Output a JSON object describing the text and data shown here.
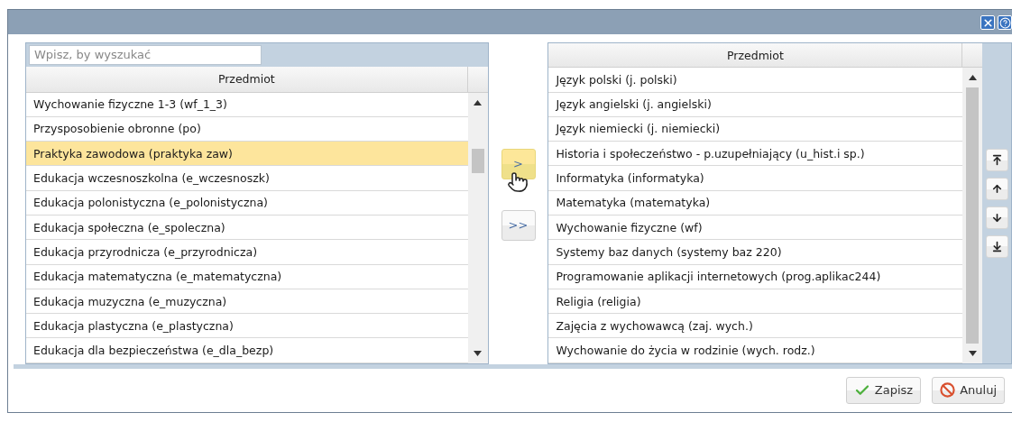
{
  "window": {
    "title_buttons": [
      {
        "kind": "close"
      },
      {
        "kind": "help"
      }
    ]
  },
  "available": {
    "search": {
      "placeholder": "Wpisz, by wyszukać"
    },
    "column": "Przedmiot",
    "rows": [
      {
        "label": "Wychowanie fizyczne 1-3 (wf_1_3)",
        "selected": false
      },
      {
        "label": "Przysposobienie obronne (po)",
        "selected": false
      },
      {
        "label": "Praktyka zawodowa (praktyka zaw)",
        "selected": true
      },
      {
        "label": "Edukacja wczesnoszkolna (e_wczesnoszk)",
        "selected": false
      },
      {
        "label": "Edukacja polonistyczna (e_polonistyczna)",
        "selected": false
      },
      {
        "label": "Edukacja społeczna (e_spoleczna)",
        "selected": false
      },
      {
        "label": "Edukacja przyrodnicza (e_przyrodnicza)",
        "selected": false
      },
      {
        "label": "Edukacja matematyczna (e_matematyczna)",
        "selected": false
      },
      {
        "label": "Edukacja muzyczna (e_muzyczna)",
        "selected": false
      },
      {
        "label": "Edukacja plastyczna (e_plastyczna)",
        "selected": false
      },
      {
        "label": "Edukacja dla bezpieczeństwa (e_dla_bezp)",
        "selected": false
      }
    ]
  },
  "transfer_buttons": [
    {
      "label": ">",
      "hovered": true
    },
    {
      "label": ">>",
      "hovered": false
    }
  ],
  "chosen": {
    "column": "Przedmiot",
    "rows": [
      {
        "label": "Język polski (j. polski)",
        "selected": false
      },
      {
        "label": "Język angielski (j. angielski)",
        "selected": false
      },
      {
        "label": "Język niemiecki (j. niemiecki)",
        "selected": false
      },
      {
        "label": "Historia i społeczeństwo - p.uzupełniający (u_hist.i sp.)",
        "selected": false
      },
      {
        "label": "Informatyka (informatyka)",
        "selected": false
      },
      {
        "label": "Matematyka (matematyka)",
        "selected": false
      },
      {
        "label": "Wychowanie fizyczne (wf)",
        "selected": false
      },
      {
        "label": "Systemy baz danych (systemy baz 220)",
        "selected": false
      },
      {
        "label": "Programowanie aplikacji internetowych (prog.aplikac244)",
        "selected": false
      },
      {
        "label": "Religia (religia)",
        "selected": false
      },
      {
        "label": "Zajęcia z wychowawcą (zaj. wych.)",
        "selected": false
      },
      {
        "label": "Wychowanie do życia w rodzinie (wych. rodz.)",
        "selected": false
      }
    ]
  },
  "order_buttons": [
    {
      "kind": "top"
    },
    {
      "kind": "up"
    },
    {
      "kind": "down"
    },
    {
      "kind": "bottom"
    }
  ],
  "footer_buttons": [
    {
      "label": "Zapisz",
      "kind": "save"
    },
    {
      "label": "Anuluj",
      "kind": "cancel"
    }
  ]
}
